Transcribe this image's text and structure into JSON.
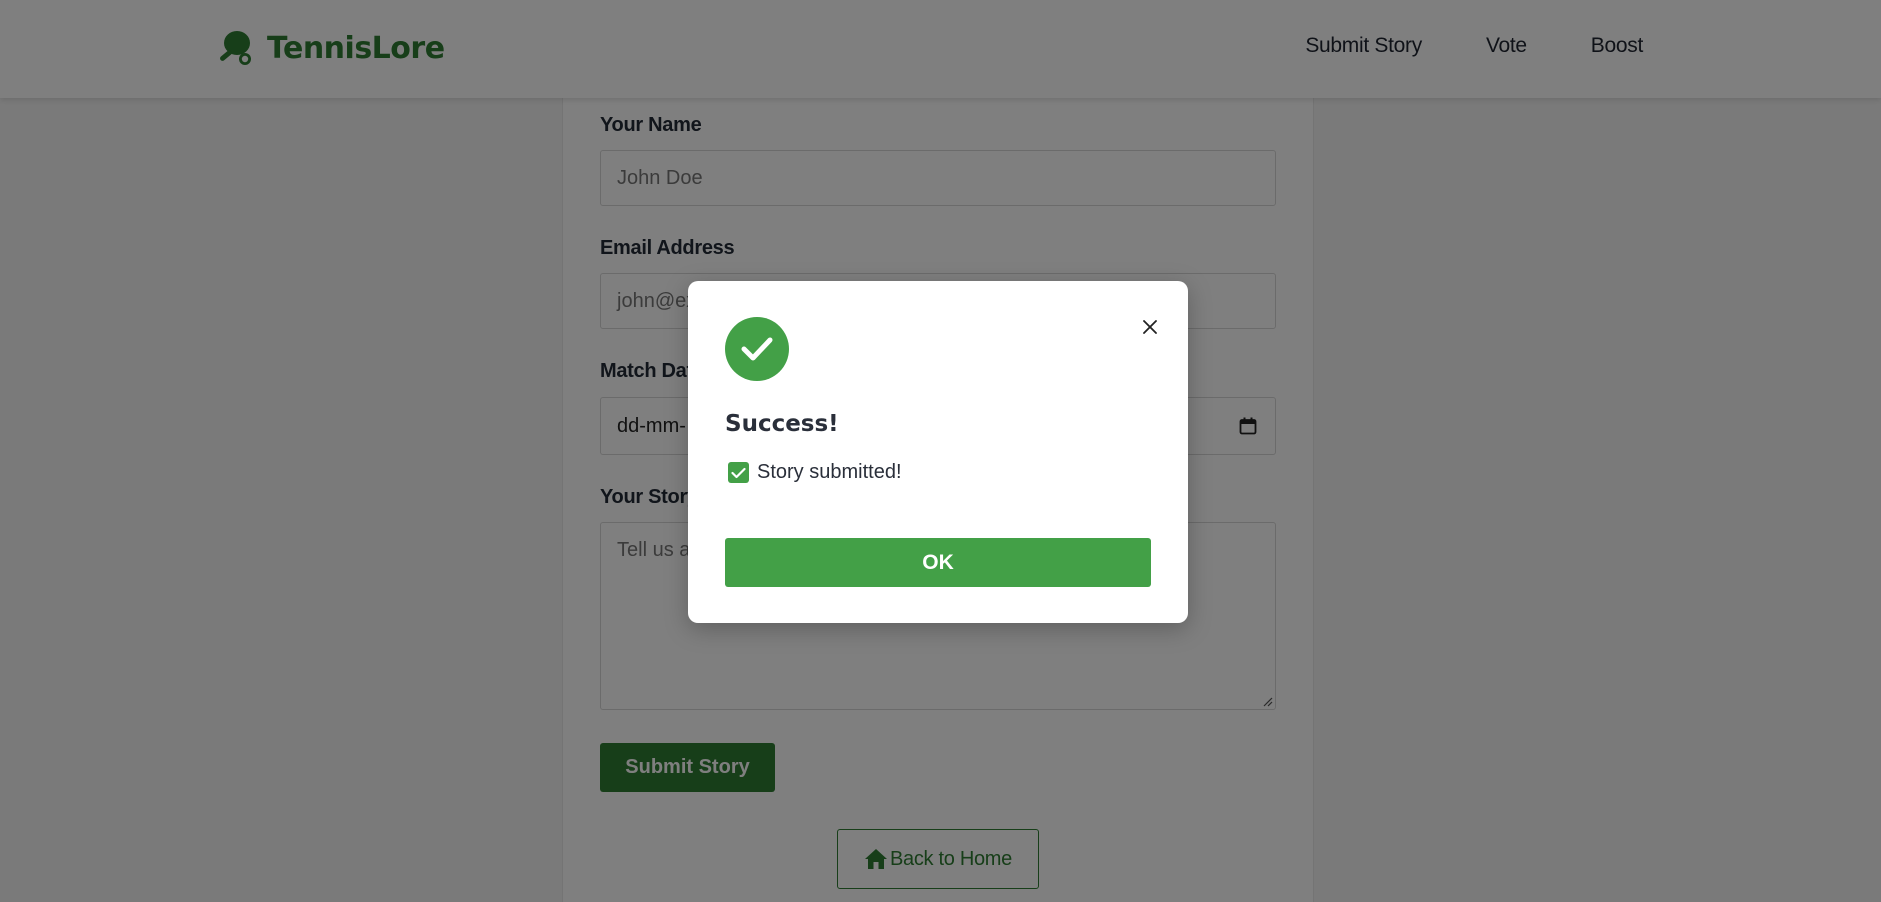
{
  "header": {
    "brand": "TennisLore",
    "nav": [
      "Submit Story",
      "Vote",
      "Boost"
    ]
  },
  "form": {
    "fields": [
      {
        "label": "Your Name",
        "placeholder": "John Doe"
      },
      {
        "label": "Email Address",
        "placeholder": "john@ex"
      },
      {
        "label": "Match Date",
        "value": "dd-mm-"
      },
      {
        "label": "Your Story",
        "placeholder": "Tell us al"
      }
    ],
    "submit_label": "Submit Story",
    "home_label": "Back to Home"
  },
  "modal": {
    "title": "Success!",
    "message": "Story submitted!",
    "ok_label": "OK"
  },
  "colors": {
    "brand_green": "#2e7d32",
    "success_green": "#43a047"
  }
}
